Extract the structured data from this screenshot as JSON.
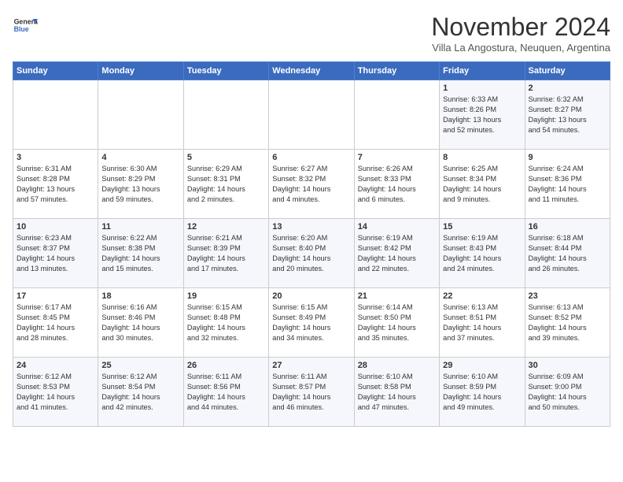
{
  "header": {
    "logo_line1": "General",
    "logo_line2": "Blue",
    "month": "November 2024",
    "location": "Villa La Angostura, Neuquen, Argentina"
  },
  "columns": [
    "Sunday",
    "Monday",
    "Tuesday",
    "Wednesday",
    "Thursday",
    "Friday",
    "Saturday"
  ],
  "rows": [
    [
      {
        "day": "",
        "info": ""
      },
      {
        "day": "",
        "info": ""
      },
      {
        "day": "",
        "info": ""
      },
      {
        "day": "",
        "info": ""
      },
      {
        "day": "",
        "info": ""
      },
      {
        "day": "1",
        "info": "Sunrise: 6:33 AM\nSunset: 8:26 PM\nDaylight: 13 hours\nand 52 minutes."
      },
      {
        "day": "2",
        "info": "Sunrise: 6:32 AM\nSunset: 8:27 PM\nDaylight: 13 hours\nand 54 minutes."
      }
    ],
    [
      {
        "day": "3",
        "info": "Sunrise: 6:31 AM\nSunset: 8:28 PM\nDaylight: 13 hours\nand 57 minutes."
      },
      {
        "day": "4",
        "info": "Sunrise: 6:30 AM\nSunset: 8:29 PM\nDaylight: 13 hours\nand 59 minutes."
      },
      {
        "day": "5",
        "info": "Sunrise: 6:29 AM\nSunset: 8:31 PM\nDaylight: 14 hours\nand 2 minutes."
      },
      {
        "day": "6",
        "info": "Sunrise: 6:27 AM\nSunset: 8:32 PM\nDaylight: 14 hours\nand 4 minutes."
      },
      {
        "day": "7",
        "info": "Sunrise: 6:26 AM\nSunset: 8:33 PM\nDaylight: 14 hours\nand 6 minutes."
      },
      {
        "day": "8",
        "info": "Sunrise: 6:25 AM\nSunset: 8:34 PM\nDaylight: 14 hours\nand 9 minutes."
      },
      {
        "day": "9",
        "info": "Sunrise: 6:24 AM\nSunset: 8:36 PM\nDaylight: 14 hours\nand 11 minutes."
      }
    ],
    [
      {
        "day": "10",
        "info": "Sunrise: 6:23 AM\nSunset: 8:37 PM\nDaylight: 14 hours\nand 13 minutes."
      },
      {
        "day": "11",
        "info": "Sunrise: 6:22 AM\nSunset: 8:38 PM\nDaylight: 14 hours\nand 15 minutes."
      },
      {
        "day": "12",
        "info": "Sunrise: 6:21 AM\nSunset: 8:39 PM\nDaylight: 14 hours\nand 17 minutes."
      },
      {
        "day": "13",
        "info": "Sunrise: 6:20 AM\nSunset: 8:40 PM\nDaylight: 14 hours\nand 20 minutes."
      },
      {
        "day": "14",
        "info": "Sunrise: 6:19 AM\nSunset: 8:42 PM\nDaylight: 14 hours\nand 22 minutes."
      },
      {
        "day": "15",
        "info": "Sunrise: 6:19 AM\nSunset: 8:43 PM\nDaylight: 14 hours\nand 24 minutes."
      },
      {
        "day": "16",
        "info": "Sunrise: 6:18 AM\nSunset: 8:44 PM\nDaylight: 14 hours\nand 26 minutes."
      }
    ],
    [
      {
        "day": "17",
        "info": "Sunrise: 6:17 AM\nSunset: 8:45 PM\nDaylight: 14 hours\nand 28 minutes."
      },
      {
        "day": "18",
        "info": "Sunrise: 6:16 AM\nSunset: 8:46 PM\nDaylight: 14 hours\nand 30 minutes."
      },
      {
        "day": "19",
        "info": "Sunrise: 6:15 AM\nSunset: 8:48 PM\nDaylight: 14 hours\nand 32 minutes."
      },
      {
        "day": "20",
        "info": "Sunrise: 6:15 AM\nSunset: 8:49 PM\nDaylight: 14 hours\nand 34 minutes."
      },
      {
        "day": "21",
        "info": "Sunrise: 6:14 AM\nSunset: 8:50 PM\nDaylight: 14 hours\nand 35 minutes."
      },
      {
        "day": "22",
        "info": "Sunrise: 6:13 AM\nSunset: 8:51 PM\nDaylight: 14 hours\nand 37 minutes."
      },
      {
        "day": "23",
        "info": "Sunrise: 6:13 AM\nSunset: 8:52 PM\nDaylight: 14 hours\nand 39 minutes."
      }
    ],
    [
      {
        "day": "24",
        "info": "Sunrise: 6:12 AM\nSunset: 8:53 PM\nDaylight: 14 hours\nand 41 minutes."
      },
      {
        "day": "25",
        "info": "Sunrise: 6:12 AM\nSunset: 8:54 PM\nDaylight: 14 hours\nand 42 minutes."
      },
      {
        "day": "26",
        "info": "Sunrise: 6:11 AM\nSunset: 8:56 PM\nDaylight: 14 hours\nand 44 minutes."
      },
      {
        "day": "27",
        "info": "Sunrise: 6:11 AM\nSunset: 8:57 PM\nDaylight: 14 hours\nand 46 minutes."
      },
      {
        "day": "28",
        "info": "Sunrise: 6:10 AM\nSunset: 8:58 PM\nDaylight: 14 hours\nand 47 minutes."
      },
      {
        "day": "29",
        "info": "Sunrise: 6:10 AM\nSunset: 8:59 PM\nDaylight: 14 hours\nand 49 minutes."
      },
      {
        "day": "30",
        "info": "Sunrise: 6:09 AM\nSunset: 9:00 PM\nDaylight: 14 hours\nand 50 minutes."
      }
    ]
  ]
}
